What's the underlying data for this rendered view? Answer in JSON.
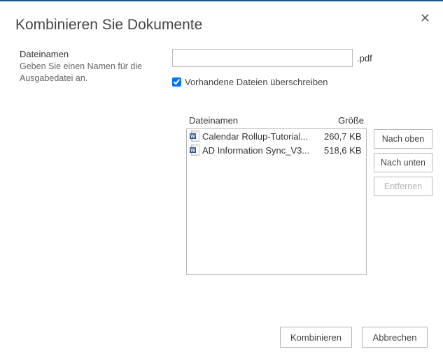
{
  "title": "Kombinieren Sie Dokumente",
  "close_glyph": "✕",
  "filename": {
    "label": "Dateinamen",
    "hint": "Geben Sie einen Namen für die Ausgabedatei an.",
    "value": "",
    "extension": ".pdf"
  },
  "overwrite": {
    "label": "Vorhandene Dateien überschreiben",
    "checked": true
  },
  "list": {
    "header_name": "Dateinamen",
    "header_size": "Größe",
    "items": [
      {
        "name": "Calendar Rollup-Tutorial...",
        "size": "260,7 KB"
      },
      {
        "name": "AD Information Sync_V3...",
        "size": "518,6 KB"
      }
    ]
  },
  "buttons": {
    "move_up": "Nach oben",
    "move_down": "Nach unten",
    "remove": "Entfernen"
  },
  "footer": {
    "combine": "Kombinieren",
    "cancel": "Abbrechen"
  }
}
